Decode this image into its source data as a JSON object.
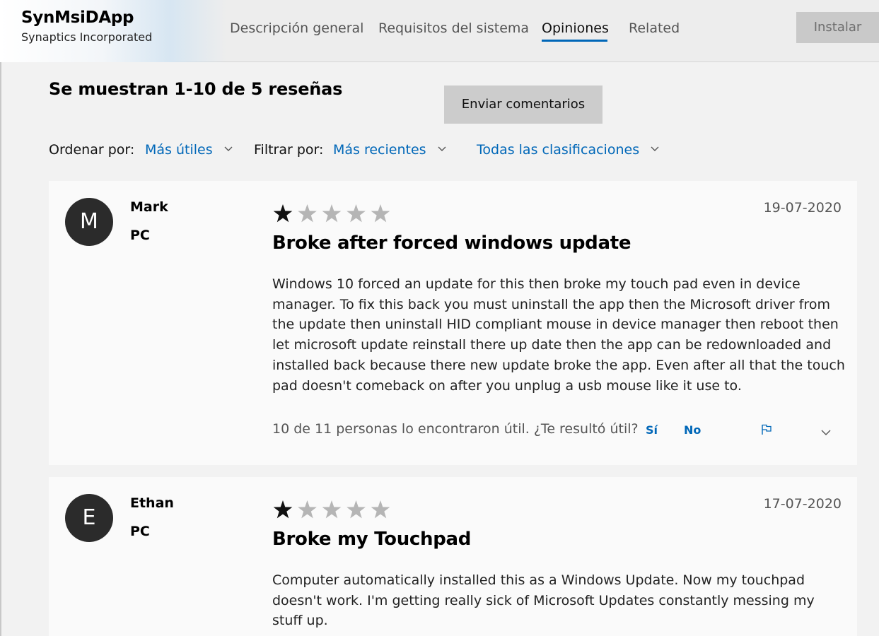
{
  "header": {
    "app_name": "SynMsiDApp",
    "publisher": "Synaptics Incorporated",
    "tabs": [
      {
        "label": "Descripción general",
        "active": false
      },
      {
        "label": "Requisitos del sistema",
        "active": false
      },
      {
        "label": "Opiniones",
        "active": true
      },
      {
        "label": "Related",
        "active": false
      }
    ],
    "install_label": "Instalar"
  },
  "reviews_section": {
    "heading": "Se muestran 1-10 de 5 reseñas",
    "send_feedback_label": "Enviar comentarios",
    "sort_label": "Ordenar por:",
    "sort_value": "Más útiles",
    "filter_label": "Filtrar por:",
    "filter_value": "Más recientes",
    "ratings_filter_value": "Todas las clasificaciones"
  },
  "reviews": [
    {
      "avatar_letter": "M",
      "name": "Mark",
      "device": "PC",
      "rating": 1,
      "max_rating": 5,
      "date": "19-07-2020",
      "title": "Broke after forced windows update",
      "body": "Windows 10 forced an update for this then broke my touch pad even in device manager. To fix this back you must uninstall the app then the Microsoft driver from the update then uninstall HID compliant mouse in device manager then reboot then let microsoft update reinstall there up date then the app can be redownloaded and installed back because there new update broke the app. Even after all that the touch pad doesn't comeback on after you unplug a usb mouse like it use to.",
      "helpful_text": "10 de 11 personas lo encontraron útil. ¿Te resultó útil?",
      "yes_label": "Sí",
      "no_label": "No"
    },
    {
      "avatar_letter": "E",
      "name": "Ethan",
      "device": "PC",
      "rating": 1,
      "max_rating": 5,
      "date": "17-07-2020",
      "title": "Broke my Touchpad",
      "body": "Computer automatically installed this as a Windows Update. Now my touchpad doesn't work. I'm getting really sick of Microsoft Updates constantly messing my stuff up."
    }
  ],
  "icons": {
    "star": "star-icon",
    "flag": "flag-icon",
    "chevron": "chevron-down-icon"
  },
  "colors": {
    "accent": "#0067b8",
    "avatar_bg": "#2b2b2b",
    "star_filled": "#111111",
    "star_empty": "#b5b5b5",
    "install_bg": "#c9c9c9"
  }
}
